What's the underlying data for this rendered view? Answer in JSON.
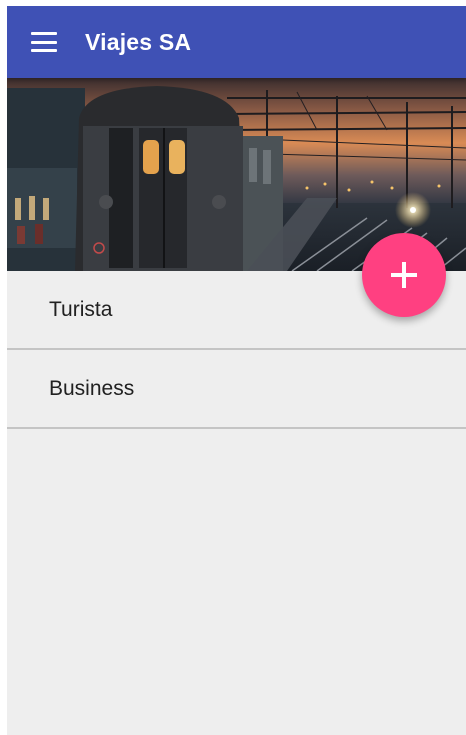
{
  "app_bar": {
    "title": "Viajes SA",
    "menu_icon": "hamburger-menu-icon",
    "color": "#3f51b5"
  },
  "hero_image": {
    "subject": "train-at-station-sunset"
  },
  "list": {
    "items": [
      {
        "label": "Turista"
      },
      {
        "label": "Business"
      }
    ]
  },
  "fab": {
    "icon": "add-icon",
    "color": "#ff4081"
  }
}
